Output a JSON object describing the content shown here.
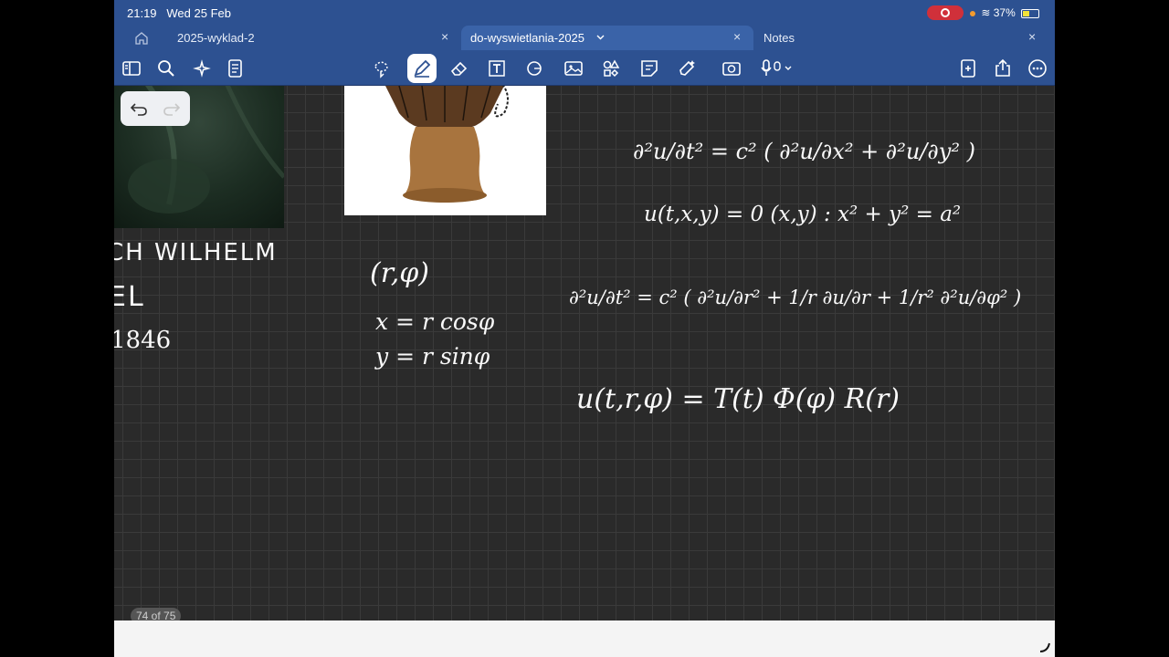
{
  "status": {
    "time": "21:19",
    "date": "Wed 25 Feb",
    "battery": "37%"
  },
  "tabs": {
    "tab1_label": "2025-wyklad-2",
    "tab2_label": "do-wyswietlania-2025",
    "tab3_label": "Notes",
    "close_glyph": "×"
  },
  "toolbar": {
    "icons": [
      "sidebar-icon",
      "search-icon",
      "sparkle-icon",
      "document-icon",
      "lasso-icon",
      "pen-icon",
      "eraser-icon",
      "textbox-icon",
      "shapes-icon",
      "image-icon",
      "elements-icon",
      "sticky-note-icon",
      "highlighter-icon",
      "camera-icon",
      "microphone-icon",
      "add-page-icon",
      "share-icon",
      "more-icon"
    ]
  },
  "page": {
    "indicator": "74 of 75"
  },
  "notes": {
    "name1": "CH WILHELM",
    "name2": "EL",
    "year": "1846",
    "polar_pair": "(r,φ)",
    "x_eq": "x = r cosφ",
    "y_eq": "y = r sinφ",
    "wave_eq": "∂²u/∂t² = c² ( ∂²u/∂x² + ∂²u/∂y² )",
    "boundary": "u(t,x,y) = 0     (x,y) : x² + y² = a²",
    "polar_wave": "∂²u/∂t² = c² ( ∂²u/∂r² + 1/r ∂u/∂r + 1/r² ∂²u/∂φ² )",
    "separation": "u(t,r,φ) = T(t) Φ(φ) R(r)"
  }
}
